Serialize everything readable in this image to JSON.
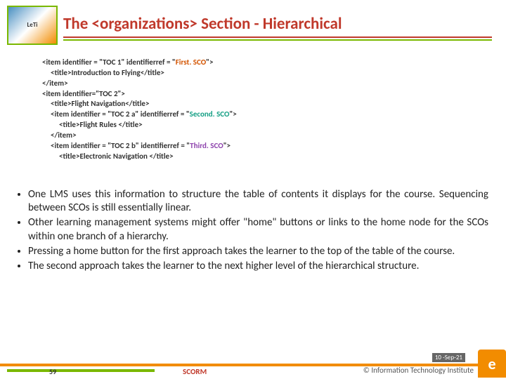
{
  "header": {
    "title": "The <organizations> Section - Hierarchical",
    "logo_alt": "LeTi Learning"
  },
  "code": {
    "l1_pre": "<item identifier = \"TOC 1\" identifierref = \"",
    "l1_sco": "First. SCO",
    "l1_post": "\">",
    "l2": "<title>Introduction to Flying</title>",
    "l3": "</item>",
    "l4": "<item identifier=\"TOC 2\">",
    "l5": "<title>Flight Navigation</title>",
    "l6_pre": "<item identifier = \"TOC 2 a\" identifierref = \"",
    "l6_sco": "Second. SCO",
    "l6_post": "\">",
    "l7": "<title>Flight Rules </title>",
    "l8": "</item>",
    "l9_pre": "<item identifier = \"TOC 2 b\" identifierref = \"",
    "l9_sco": "Third. SCO",
    "l9_post": "\">",
    "l10": "<title>Electronic Navigation </title>"
  },
  "bullets": {
    "b1": "One LMS uses this information to structure the table of contents it displays for the course. Sequencing between SCOs is still essentially linear.",
    "b2": "Other learning management systems might offer \"home\" buttons or links to the home node for the SCOs within one branch of a hierarchy.",
    "b3": "Pressing a home button for the first approach takes the learner to the top of the table of the course.",
    "b4": "The second approach takes the learner to the next higher level of the hierarchical structure."
  },
  "footer": {
    "slide_number": "59",
    "label": "SCORM",
    "date": "10 -Sep-21",
    "org": "© Information Technology Institute",
    "e_logo": "e"
  }
}
